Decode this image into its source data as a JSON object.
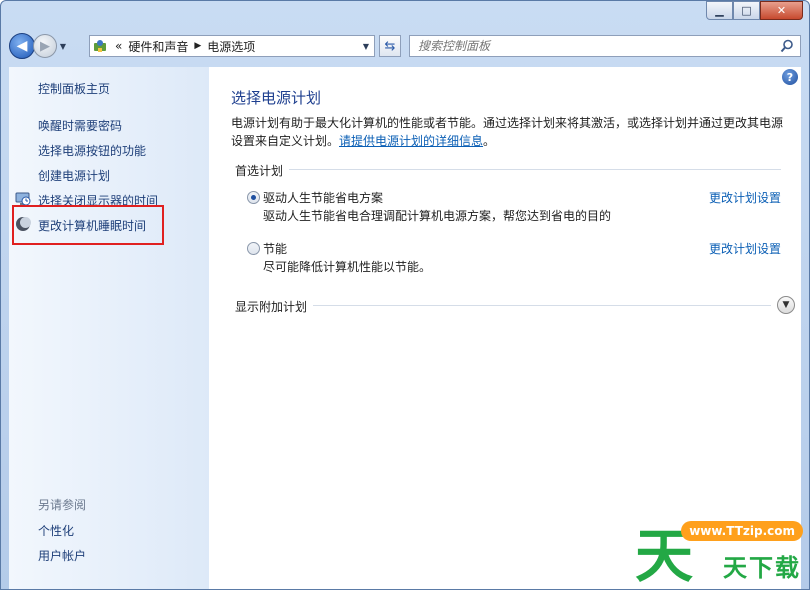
{
  "window": {
    "caption_buttons": {
      "minimize": "▁",
      "maximize": "□",
      "close": "✕"
    }
  },
  "nav": {
    "back_icon": "back-arrow-icon",
    "forward_icon": "forward-arrow-icon",
    "breadcrumb": [
      "«",
      "硬件和声音",
      "电源选项"
    ],
    "search_placeholder": "搜索控制面板"
  },
  "sidebar": {
    "home": "控制面板主页",
    "items": [
      {
        "label": "唤醒时需要密码",
        "icon": ""
      },
      {
        "label": "选择电源按钮的功能",
        "icon": ""
      },
      {
        "label": "创建电源计划",
        "icon": ""
      },
      {
        "label": "选择关闭显示器的时间",
        "icon": "monitor-clock-icon"
      },
      {
        "label": "更改计算机睡眠时间",
        "icon": "moon-icon"
      }
    ],
    "see_also": "另请参阅",
    "see_also_links": [
      "个性化",
      "用户帐户"
    ]
  },
  "main": {
    "title": "选择电源计划",
    "desc_line1": "电源计划有助于最大化计算机的性能或者节能。通过选择计划来将其激活，或选择计划并通过更改其电源",
    "desc_line2_prefix": "设置来自定义计划。",
    "desc_link": "请提供电源计划的详细信息",
    "desc_suffix": "。",
    "preferred_header": "首选计划",
    "plans": [
      {
        "name": "驱动人生节能省电方案",
        "desc": "驱动人生节能省电合理调配计算机电源方案，帮您达到省电的目的",
        "link": "更改计划设置",
        "selected": true
      },
      {
        "name": "节能",
        "desc": "尽可能降低计算机性能以节能。",
        "link": "更改计划设置",
        "selected": false
      }
    ],
    "additional_header": "显示附加计划"
  },
  "watermark": {
    "big_char": "天",
    "url": "www.TTzip.com",
    "text": "天下载"
  }
}
